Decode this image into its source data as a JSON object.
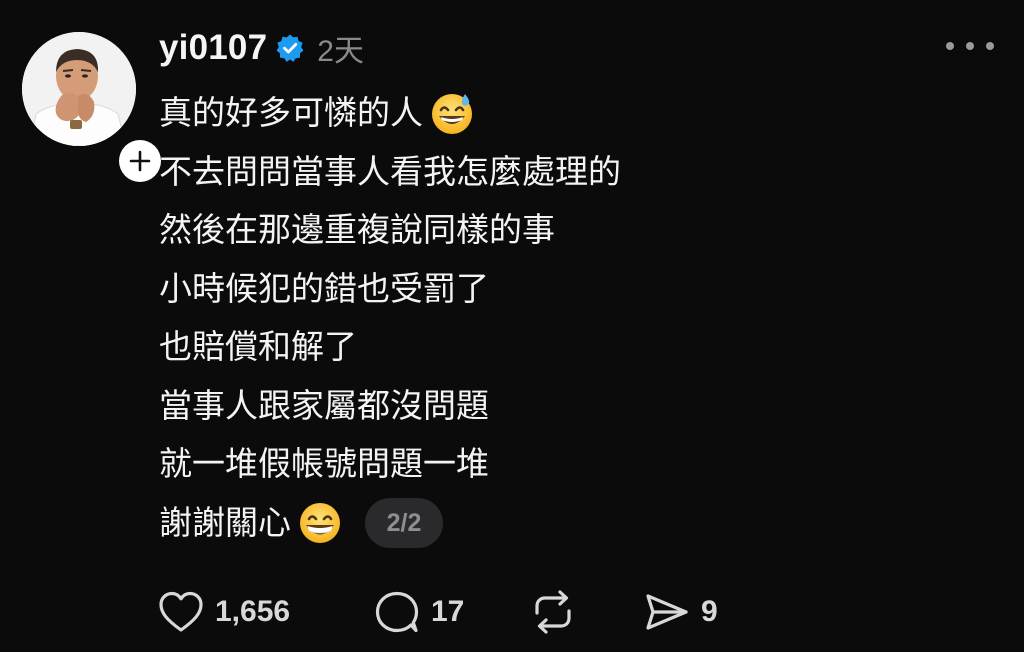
{
  "post": {
    "username": "yi0107",
    "timestamp": "2天",
    "lines": [
      "真的好多可憐的人",
      "不去問問當事人看我怎麼處理的",
      "然後在那邊重複說同樣的事",
      "小時候犯的錯也受罰了",
      "也賠償和解了",
      "當事人跟家屬都沒問題",
      "就一堆假帳號問題一堆",
      "謝謝關心"
    ],
    "line1_emoji": "grinning-face-with-sweat",
    "last_line_emoji": "beaming-face-with-smiling-eyes",
    "page_indicator": "2/2"
  },
  "actions": {
    "like_count": "1,656",
    "reply_count": "17",
    "share_count": "9"
  },
  "icons": {
    "verified": "verified-badge-icon",
    "more": "more-options-icon",
    "follow": "plus-icon",
    "like": "heart-icon",
    "reply": "speech-bubble-icon",
    "repost": "repost-icon",
    "share": "paper-plane-icon"
  },
  "colors": {
    "background": "#0b0b0c",
    "text": "#f4f4f4",
    "muted": "#8a8a8a",
    "verified_blue": "#1d9bf0"
  }
}
